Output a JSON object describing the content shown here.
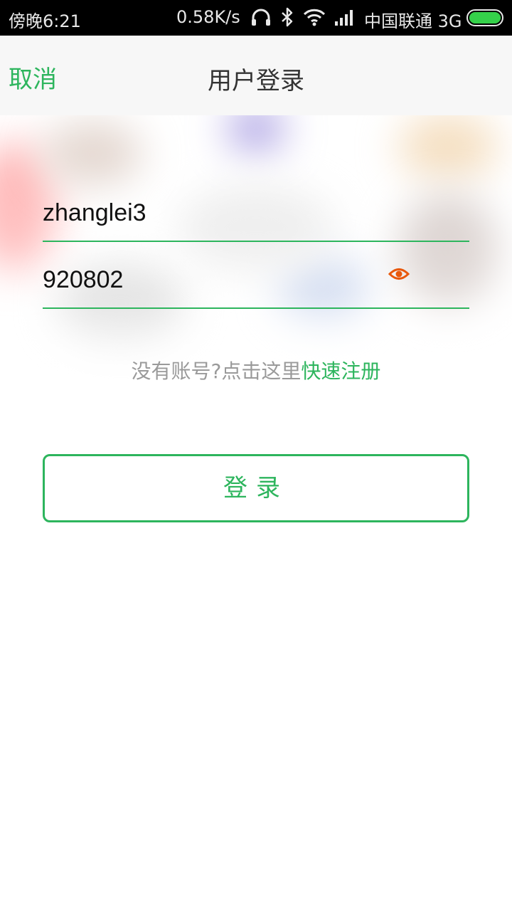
{
  "status_bar": {
    "time": "傍晚6:21",
    "net_speed": "0.58K/s",
    "carrier": "中国联通 3G",
    "icons": [
      "headphones-icon",
      "bluetooth-icon",
      "wifi-icon",
      "signal-icon",
      "battery-icon"
    ],
    "battery_color": "#35d14a"
  },
  "header": {
    "cancel_label": "取消",
    "title": "用户登录"
  },
  "form": {
    "username_value": "zhanglei3",
    "password_value": "920802",
    "show_password_icon": "eye-icon",
    "accent_color": "#2db55d",
    "eye_color": "#e8580c"
  },
  "register": {
    "prompt": "没有账号?点击这里",
    "link": "快速注册"
  },
  "login_button": {
    "label": "登录"
  }
}
